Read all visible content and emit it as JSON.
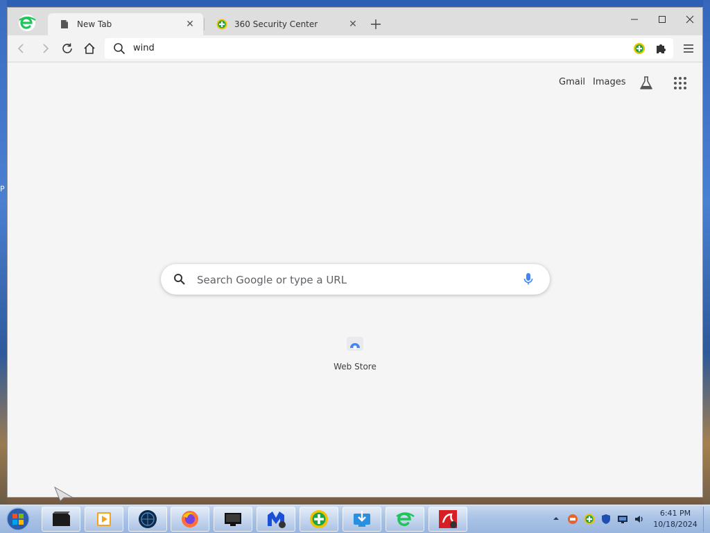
{
  "browser": {
    "tabs": [
      {
        "title": "New Tab",
        "icon": "document-icon",
        "active": true
      },
      {
        "title": "360 Security Center",
        "icon": "360-security-icon",
        "active": false
      }
    ],
    "omnibox": {
      "value": "wind"
    }
  },
  "newtab": {
    "links": {
      "gmail": "Gmail",
      "images": "Images"
    },
    "search": {
      "placeholder": "Search Google or type a URL"
    },
    "shortcuts": [
      {
        "label": "Web Store",
        "icon": "web-store-icon"
      }
    ]
  },
  "taskbar": {
    "apps": [
      "terminal-icon",
      "media-player-icon",
      "globe-icon",
      "firefox-icon",
      "monitor-icon",
      "malwarebytes-icon",
      "360-security-icon",
      "download-icon",
      "browser-e-icon",
      "red-app-icon"
    ],
    "clock": {
      "time": "6:41 PM",
      "date": "10/18/2024"
    }
  },
  "colors": {
    "accent_green": "#21c35b",
    "searchbox_bg": "#ffffff",
    "taskbar": "#aac3e6"
  }
}
